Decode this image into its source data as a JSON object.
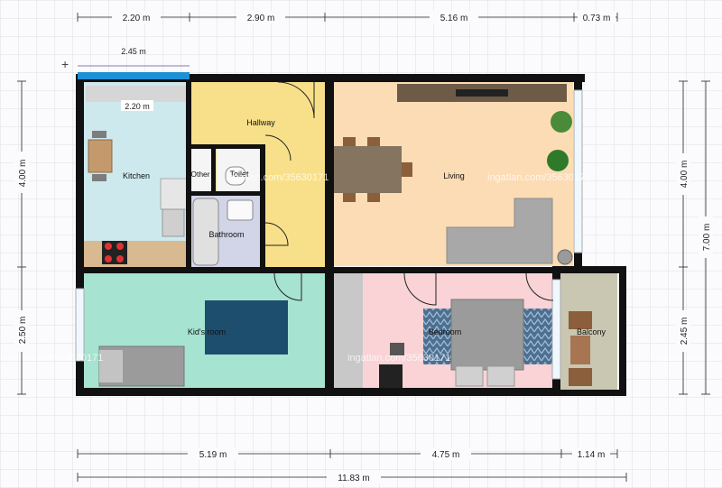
{
  "rooms": {
    "kitchen": "Kitchen",
    "hallway": "Hallway",
    "other": "Other",
    "toilet": "Toilet",
    "bathroom": "Bathroom",
    "living": "Living",
    "kids_room": "Kid's room",
    "bedroom": "Bedroom",
    "balcony": "Balcony"
  },
  "dimensions": {
    "top": [
      "2.20 m",
      "2.90 m",
      "5.16 m",
      "0.73 m"
    ],
    "window_width": "2.45 m",
    "counter_width": "2.20 m",
    "left": [
      "4.00 m",
      "2.50 m"
    ],
    "right_inner": [
      "4.00 m",
      "2.45 m"
    ],
    "right_outer": "7.00 m",
    "bottom": [
      "5.19 m",
      "4.75 m",
      "1.14 m"
    ],
    "total_width": "11.83 m"
  },
  "watermark": "ingatlan.com/35630171",
  "colors": {
    "kitchen": "#cde9ee",
    "hallway": "#f8e08a",
    "living": "#fcdcb4",
    "kids_room": "#a6e3d1",
    "bedroom": "#f9d3d6",
    "balcony": "#c9c7b1",
    "bathroom": "#d2d4e8",
    "wall": "#111111",
    "window": "#1e90d6"
  }
}
